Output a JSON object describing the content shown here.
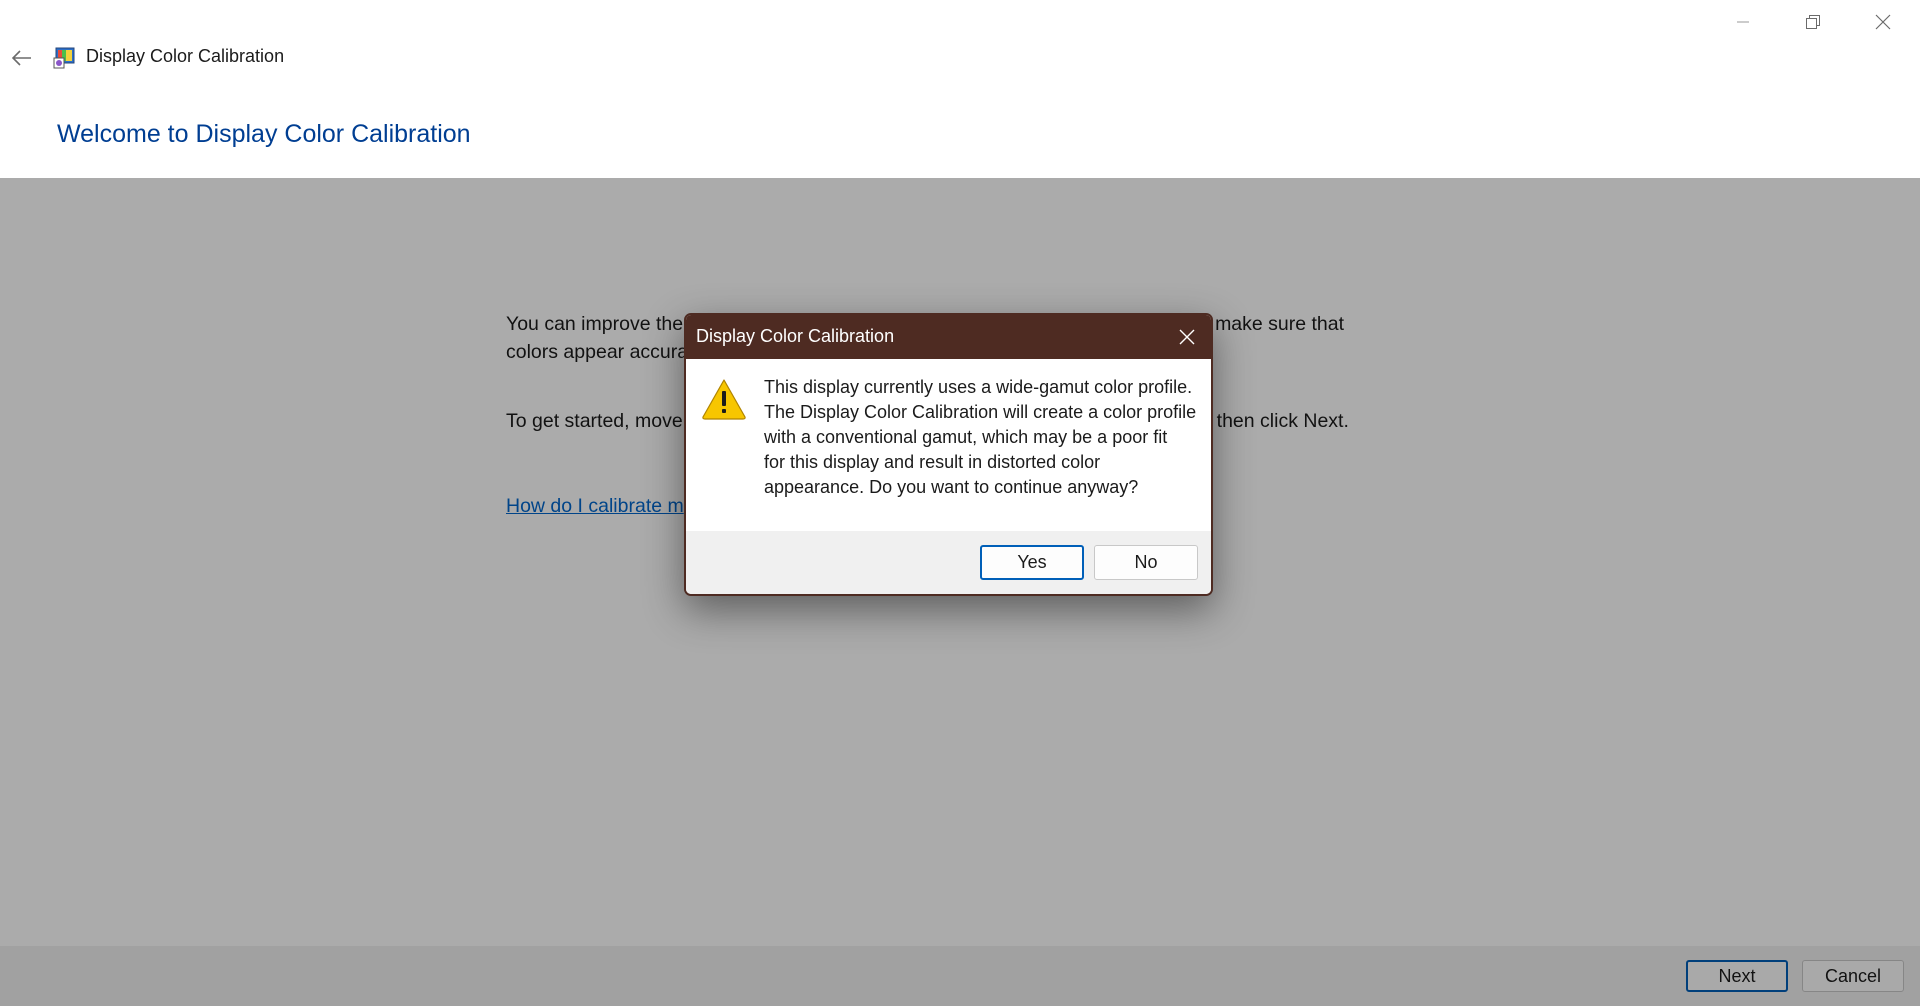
{
  "window": {
    "app_title": "Display Color Calibration",
    "back_icon": "arrow-left-icon",
    "app_icon": "display-calibration-app-icon",
    "caption_icons": [
      "minimize-icon",
      "restore-icon",
      "close-icon"
    ]
  },
  "page": {
    "heading": "Welcome to Display Color Calibration",
    "paragraph1_line1_left": "You can improve the",
    "paragraph1_line1_right": "make sure that",
    "paragraph1_line2": "colors appear accura",
    "paragraph2_left": "To get started, move",
    "paragraph2_right": "then click Next.",
    "help_link": "How do I calibrate m"
  },
  "footer": {
    "next_label": "Next",
    "cancel_label": "Cancel"
  },
  "dialog": {
    "title": "Display Color Calibration",
    "icon": "warning-icon",
    "message_lines": [
      "This display currently uses a wide-gamut color profile.",
      "The Display Color Calibration will create a color profile",
      "with a conventional gamut, which may be a poor fit",
      "for this display and result in distorted color",
      "appearance.  Do you want to continue anyway?"
    ],
    "yes_label": "Yes",
    "no_label": "No"
  },
  "colors": {
    "dialog_titlebar": "#4e2b22",
    "heading": "#003e92",
    "link": "#0066cc",
    "accent": "#005fb8",
    "warning_fill": "#f7c600"
  }
}
